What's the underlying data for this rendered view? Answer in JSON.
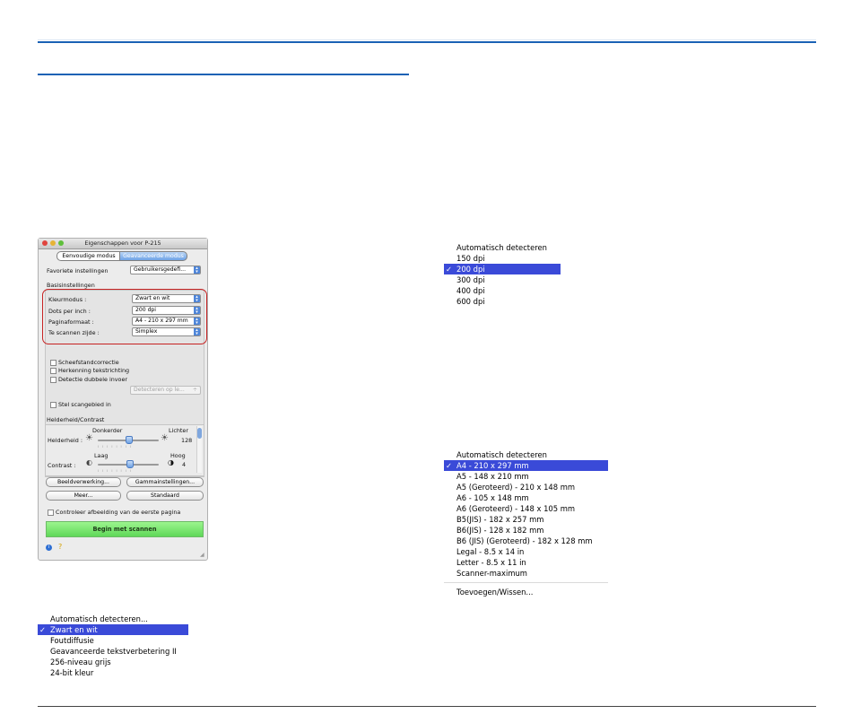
{
  "dialog": {
    "title": "Eigenschappen voor P-215",
    "mode_tabs": [
      "Eenvoudige modus",
      "Geavanceerde modus"
    ],
    "favorites_label": "Favoriete instellingen",
    "favorites_value": "Gebruikersgedefi...",
    "basic_settings_label": "Basisinstellingen",
    "color_mode_label": "Kleurmodus :",
    "color_mode_value": "Zwart en wit",
    "dpi_label": "Dots per inch :",
    "dpi_value": "200 dpi",
    "page_size_label": "Paginaformaat :",
    "page_size_value": "A4 - 210 x 297 mm",
    "side_label": "Te scannen zijde :",
    "side_value": "Simplex",
    "checkbox_deskew": "Scheefstandcorrectie",
    "checkbox_text_orientation": "Herkenning tekstrichting",
    "checkbox_double_feed": "Detectie dubbele invoer",
    "double_feed_value": "Detecteren op le...",
    "checkbox_scan_area": "Stel scangebied in",
    "brightness_contrast_label": "Helderheid/Contrast",
    "darker_label": "Donkerder",
    "lighter_label": "Lichter",
    "brightness_label": "Helderheid :",
    "brightness_value": "128",
    "low_label": "Laag",
    "high_label": "Hoog",
    "contrast_label": "Contrast :",
    "contrast_value": "4",
    "btn_image_processing": "Beeldverwerking...",
    "btn_gamma": "Gammainstellingen...",
    "btn_more": "Meer...",
    "btn_default": "Standaard",
    "checkbox_check_first_page": "Controleer afbeelding van de eerste pagina",
    "start_scan": "Begin met scannen",
    "brightness_level": 128,
    "contrast_level": 4
  },
  "dpi_menu": {
    "items": [
      "Automatisch detecteren",
      "150 dpi",
      "200 dpi",
      "300 dpi",
      "400 dpi",
      "600 dpi"
    ],
    "selected_index": 2
  },
  "page_size_menu": {
    "items": [
      "Automatisch detecteren",
      "A4 - 210 x 297 mm",
      "A5 - 148 x 210 mm",
      "A5 (Geroteerd) - 210 x 148 mm",
      "A6 - 105 x 148 mm",
      "A6 (Geroteerd) - 148 x 105 mm",
      "B5(JIS) - 182 x 257 mm",
      "B6(JIS) - 128 x 182 mm",
      "B6 (JIS) (Geroteerd) - 182 x 128 mm",
      "Legal - 8.5 x 14 in",
      "Letter - 8.5 x 11 in",
      "Scanner-maximum"
    ],
    "selected_index": 1,
    "footer_item": "Toevoegen/Wissen..."
  },
  "color_mode_menu": {
    "items": [
      "Automatisch detecteren...",
      "Zwart en wit",
      "Foutdiffusie",
      "Geavanceerde tekstverbetering II",
      "256-niveau grijs",
      "24-bit kleur"
    ],
    "selected_index": 1
  },
  "colors": {
    "accent_blue": "#1a62b5",
    "menu_selection": "#3a4ad8",
    "highlight_red": "#c62222",
    "scan_green": "#5fd858"
  }
}
